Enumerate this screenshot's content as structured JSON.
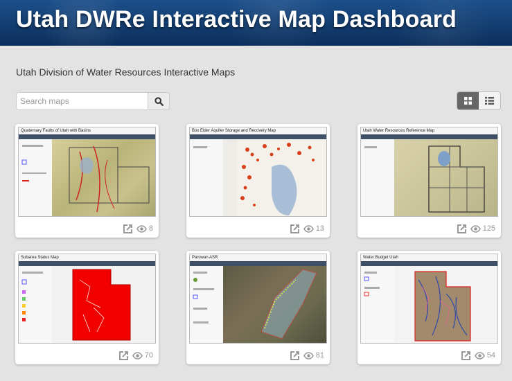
{
  "header": {
    "title": "Utah DWRe Interactive Map Dashboard"
  },
  "subtitle": "Utah Division of Water Resources Interactive Maps",
  "search": {
    "placeholder": "Search maps"
  },
  "view_toggle": {
    "active": "grid",
    "options": [
      "grid",
      "list"
    ]
  },
  "maps": [
    {
      "title": "Quaternary Faults of Utah with Basins",
      "views": "8"
    },
    {
      "title": "Box Elder Aquifer Storage and Recovery Map",
      "views": "13"
    },
    {
      "title": "Utah Water Resources Reference Map",
      "views": "125"
    },
    {
      "title": "Subarea Status Map",
      "views": "70"
    },
    {
      "title": "Parowan ASR",
      "views": "81"
    },
    {
      "title": "Water Budget Utah",
      "views": "54"
    }
  ],
  "colors": {
    "banner": "#123d70",
    "background": "#e3e3e3",
    "stats": "#999999"
  },
  "icons": [
    "search-icon",
    "grid-view-icon",
    "list-view-icon",
    "open-external-icon",
    "eye-icon"
  ]
}
